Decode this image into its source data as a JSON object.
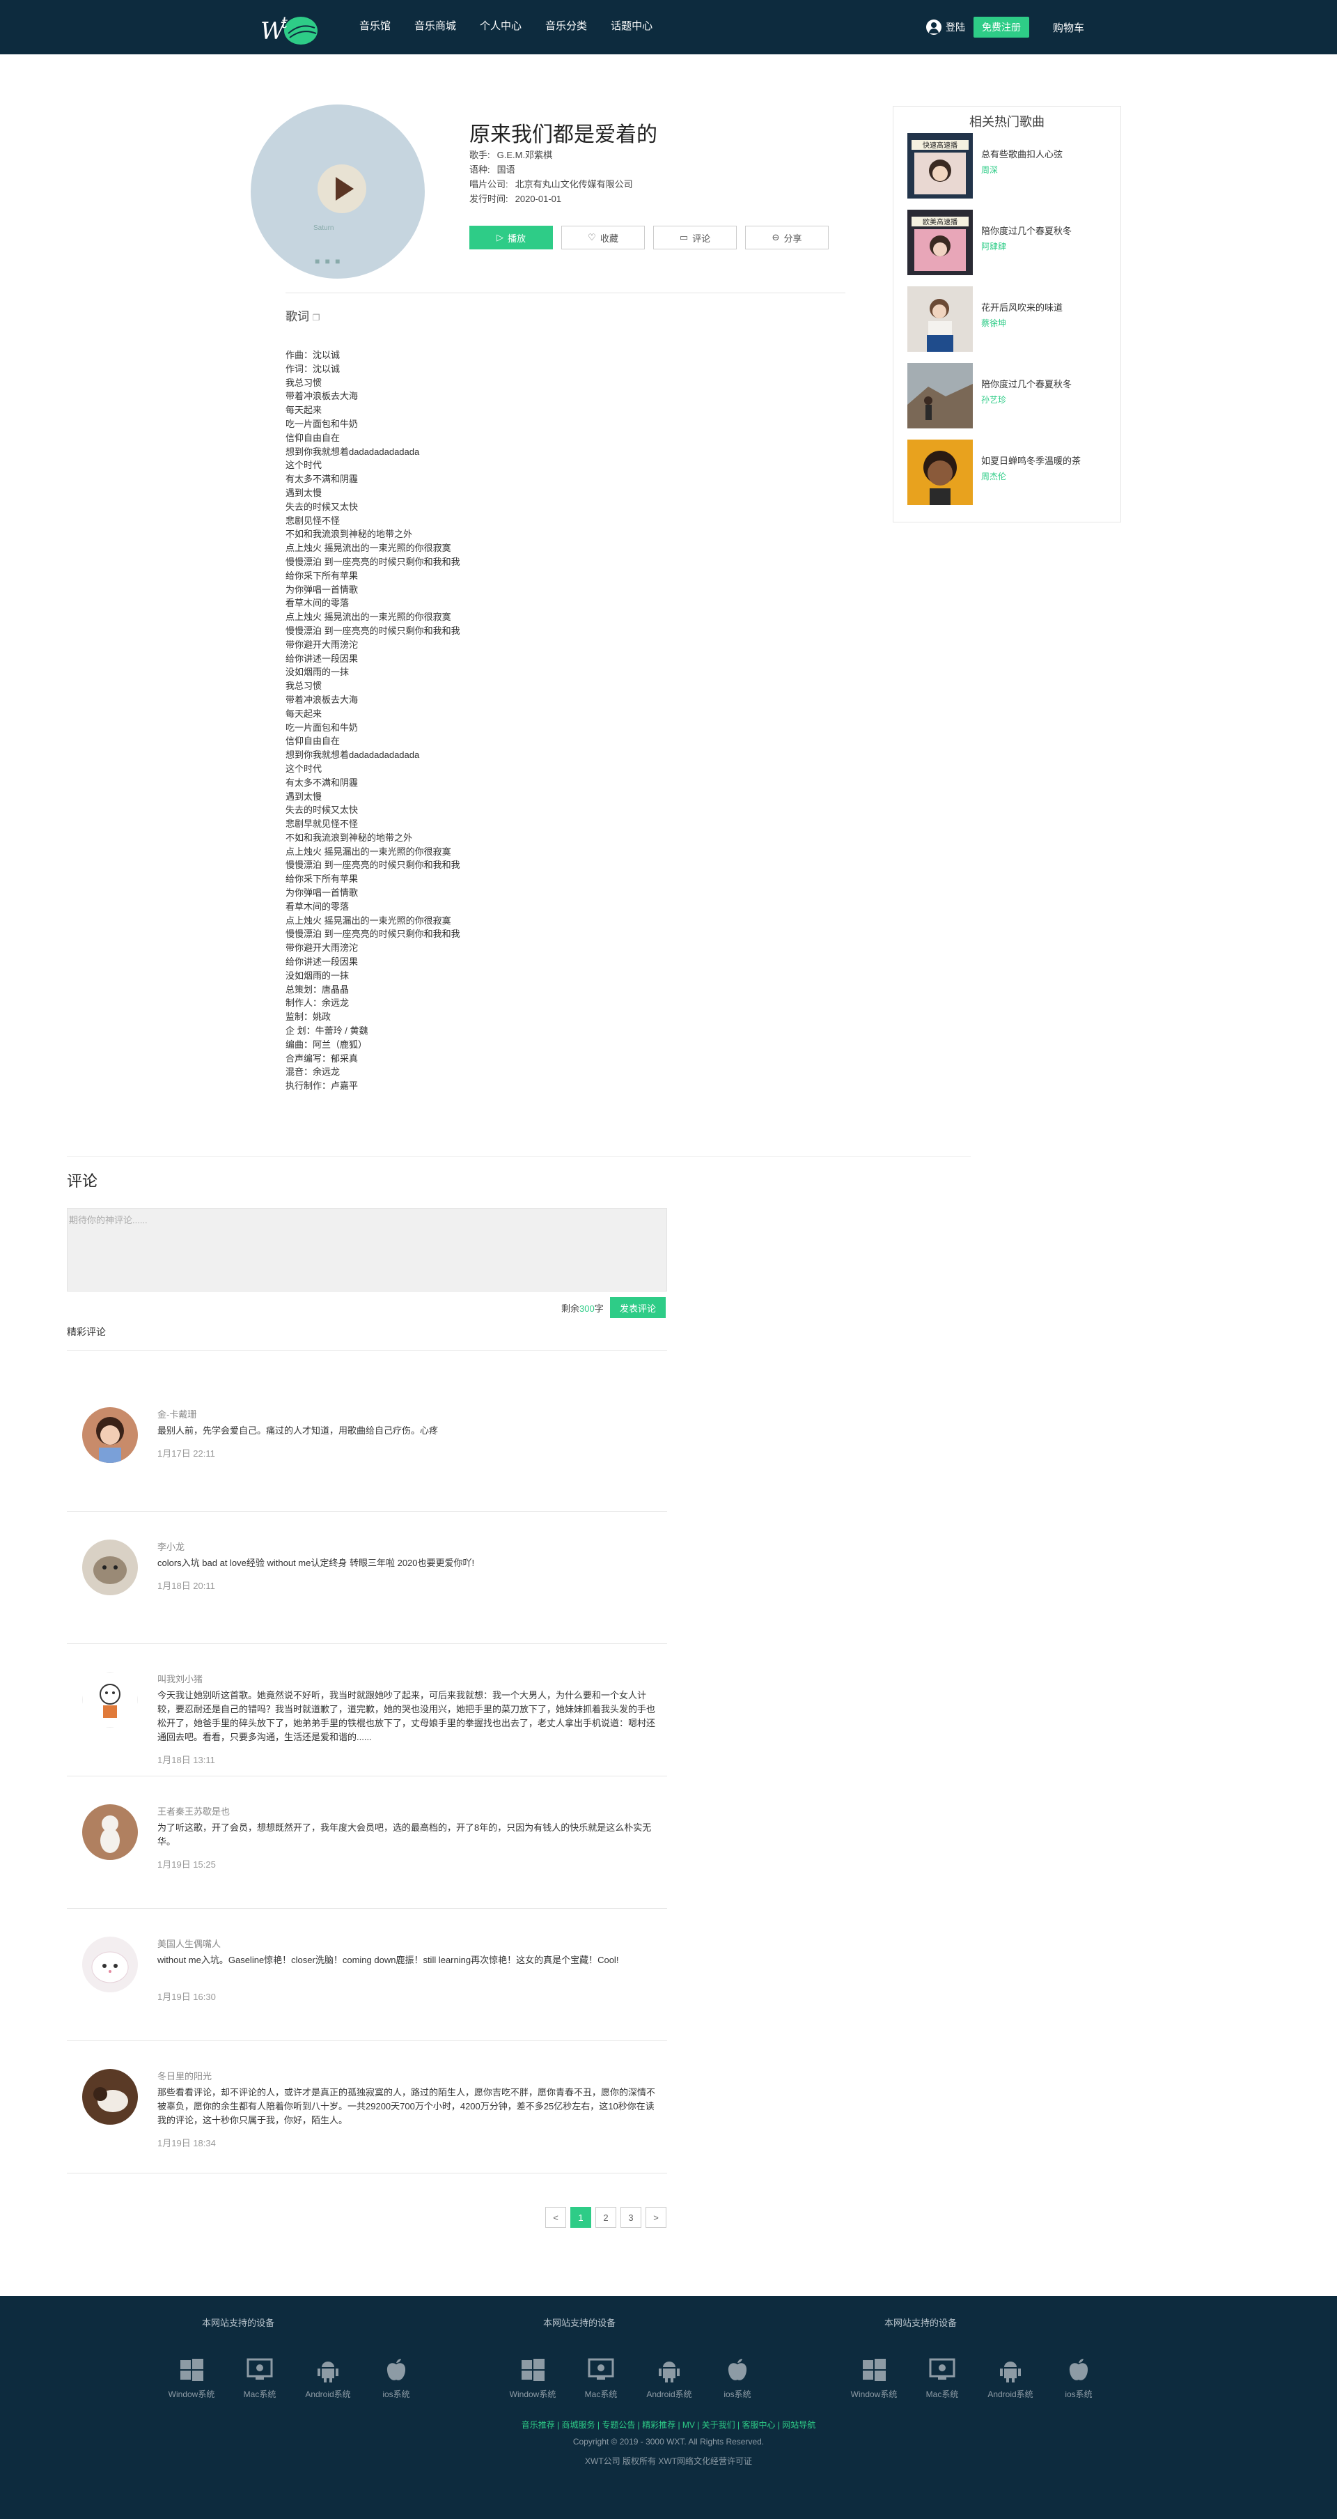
{
  "header": {
    "nav": [
      "音乐馆",
      "音乐商城",
      "个人中心",
      "音乐分类",
      "话题中心"
    ],
    "login": "登陆",
    "register": "免费注册",
    "cart": "购物车"
  },
  "album": {
    "disc_text": "Saturn",
    "title": "原来我们都是爱着的",
    "meta": [
      {
        "k": "歌手:",
        "v": "G.E.M.邓紫棋"
      },
      {
        "k": "语种:",
        "v": "国语"
      },
      {
        "k": "唱片公司:",
        "v": "北京有丸山文化传媒有限公司"
      },
      {
        "k": "发行时间:",
        "v": "2020-01-01"
      }
    ],
    "buttons": {
      "play": "播放",
      "collect": "收藏",
      "comment": "评论",
      "share": "分享"
    }
  },
  "lyrics": {
    "heading": "歌词",
    "lines": [
      "作曲：沈以诚",
      "作词：沈以诚",
      "我总习惯",
      "带着冲浪板去大海",
      "每天起来",
      "吃一片面包和牛奶",
      "信仰自由自在",
      "想到你我就想着dadadadadadada",
      "这个时代",
      "有太多不满和阴霾",
      "遇到太慢",
      "失去的时候又太快",
      "悲剧见怪不怪",
      "不如和我流浪到神秘的地带之外",
      "点上烛火 摇晃流出的一束光照的你很寂寞",
      "慢慢漂泊 到一座亮亮的时候只剩你和我和我",
      "给你采下所有苹果",
      "为你弹唱一首情歌",
      "看草木间的零落",
      "点上烛火 摇晃流出的一束光照的你很寂寞",
      "慢慢漂泊 到一座亮亮的时候只剩你和我和我",
      "带你避开大雨滂沱",
      "给你讲述一段因果",
      "没如烟雨的一抹",
      "我总习惯",
      "带着冲浪板去大海",
      "每天起来",
      "吃一片面包和牛奶",
      "信仰自由自在",
      "想到你我就想着dadadadadadada",
      "这个时代",
      "有太多不满和阴霾",
      "遇到太慢",
      "失去的时候又太快",
      "悲剧早就见怪不怪",
      "不如和我流浪到神秘的地带之外",
      "点上烛火 摇晃漏出的一束光照的你很寂寞",
      "慢慢漂泊 到一座亮亮的时候只剩你和我和我",
      "给你采下所有苹果",
      "为你弹唱一首情歌",
      "看草木间的零落",
      "点上烛火 摇晃漏出的一束光照的你很寂寞",
      "慢慢漂泊 到一座亮亮的时候只剩你和我和我",
      "带你避开大雨滂沱",
      "给你讲述一段因果",
      "没如烟雨的一抹",
      "总策划：唐晶晶",
      "制作人：余远龙",
      "监制：姚政",
      "企 划：牛蕾玲 / 黄魏",
      "编曲：阿兰（鹿狐）",
      "合声编写：郁采真",
      "混音：余远龙",
      "执行制作：卢嘉平"
    ]
  },
  "sidebar": {
    "title": "相关热门歌曲",
    "items": [
      {
        "name": "总有些歌曲扣人心弦",
        "artist": "周深",
        "cover_label": "快速高速播"
      },
      {
        "name": "陪你度过几个春夏秋冬",
        "artist": "阿肆肆",
        "cover_label": "欧美高速播"
      },
      {
        "name": "花开后风吹来的味道",
        "artist": "蔡徐坤",
        "cover_label": ""
      },
      {
        "name": "陪你度过几个春夏秋冬",
        "artist": "孙艺珍",
        "cover_label": ""
      },
      {
        "name": "如夏日蝉鸣冬季温暖的茶",
        "artist": "周杰伦",
        "cover_label": ""
      }
    ]
  },
  "comments": {
    "title": "评论",
    "placeholder": "期待你的神评论......",
    "remain_prefix": "剩余",
    "remain_count": "300",
    "remain_suffix": "字",
    "submit": "发表评论",
    "label": "精彩评论",
    "list": [
      {
        "user": "金-卡戴珊",
        "text": "最别人前，先学会爱自己。痛过的人才知道，用歌曲给自己疗伤。心疼",
        "time": "1月17日 22:11"
      },
      {
        "user": "李小龙",
        "text": "colors入坑 bad at love经验 without me认定终身 转眼三年啦 2020也要更爱你吖!",
        "time": "1月18日 20:11"
      },
      {
        "user": "叫我刘小猪",
        "text": "今天我让她别听这首歌。她竟然说不好听，我当时就跟她吵了起来，可后来我就想：我一个大男人，为什么要和一个女人计较，要忍耐还是自己的错吗？我当时就道歉了，道完歉，她的哭也没用兴，她把手里的菜刀放下了，她妹妹抓着我头发的手也松开了，她爸手里的碎头放下了，她弟弟手里的铁棍也放下了，丈母娘手里的拳握找也出去了，老丈人拿出手机说道：嗯村还通回去吧。看看，只要多沟通，生活还是爱和谐的......",
        "time": "1月18日 13:11"
      },
      {
        "user": "王者秦王苏歇是也",
        "text": "为了听这歌，开了会员，想想既然开了，我年度大会员吧，选的最高档的，开了8年的，只因为有钱人的快乐就是这么朴实无华。",
        "time": "1月19日 15:25"
      },
      {
        "user": "美国人生偶嘴人",
        "text": "without me入坑。Gaseline惊艳！closer洗脑！coming down鹿振！still learning再次惊艳！这女的真是个宝藏！Cool!",
        "time": "1月19日 16:30"
      },
      {
        "user": "冬日里的阳光",
        "text": "那些看看评论，却不评论的人，或许才是真正的孤独寂寞的人，路过的陌生人，愿你吉吃不胖，愿你青春不丑，愿你的深情不被辜负，愿你的余生都有人陪着你听到八十岁。一共29200天700万个小时，4200万分钟，差不多25亿秒左右，这10秒你在读我的评论，这十秒你只属于我，你好，陌生人。",
        "time": "1月19日 18:34"
      }
    ]
  },
  "pager": [
    "<",
    "1",
    "2",
    "3",
    ">"
  ],
  "footer": {
    "device_title": "本网站支持的设备",
    "devices": [
      "Window系统",
      "Mac系统",
      "Android系统",
      "ios系统"
    ],
    "links": "音乐推荐 | 商城服务 | 专题公告 | 精彩推荐 | MV | 关于我们 | 客服中心 | 网站导航",
    "copyright": "Copyright © 2019 - 3000 WXT. All Rights Reserved.",
    "license": "XWT公司 版权所有 XWT网络文化经营许可证"
  },
  "colors": {
    "accent": "#2ecc87",
    "header_bg": "#0d2b3e"
  }
}
